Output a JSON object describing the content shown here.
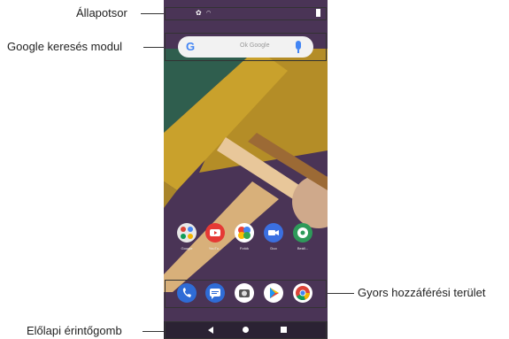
{
  "annotations": {
    "status_bar": "Állapotsor",
    "search_widget": "Google keresés modul",
    "quick_access": "Gyors hozzáférési terület",
    "home_touch_buttons": "Előlapi érintőgomb"
  },
  "status_bar": {
    "icons": [
      "settings-icon",
      "wifi-icon",
      "battery-icon"
    ]
  },
  "search_widget": {
    "logo": "G",
    "placeholder": "Ok Google"
  },
  "home_apps": [
    {
      "label": "Google",
      "icon": "google-folder-icon",
      "color": "#e8e8e8"
    },
    {
      "label": "YouTu...",
      "icon": "youtube-icon",
      "color": "#e53935"
    },
    {
      "label": "Fotók",
      "icon": "photos-icon",
      "color": "#ffffff"
    },
    {
      "label": "Duo",
      "icon": "duo-icon",
      "color": "#3b6fe0"
    },
    {
      "label": "Beáll...",
      "icon": "settings-icon",
      "color": "#2e9a5a"
    }
  ],
  "dock_apps": [
    {
      "icon": "phone-icon",
      "color": "#2f6cd6"
    },
    {
      "icon": "messages-icon",
      "color": "#2f6cd6"
    },
    {
      "icon": "camera-icon",
      "color": "#ffffff"
    },
    {
      "icon": "play-store-icon",
      "color": "#ffffff"
    },
    {
      "icon": "chrome-icon",
      "color": "#ffffff"
    }
  ],
  "nav_buttons": [
    "back-button",
    "home-button",
    "recents-button"
  ]
}
